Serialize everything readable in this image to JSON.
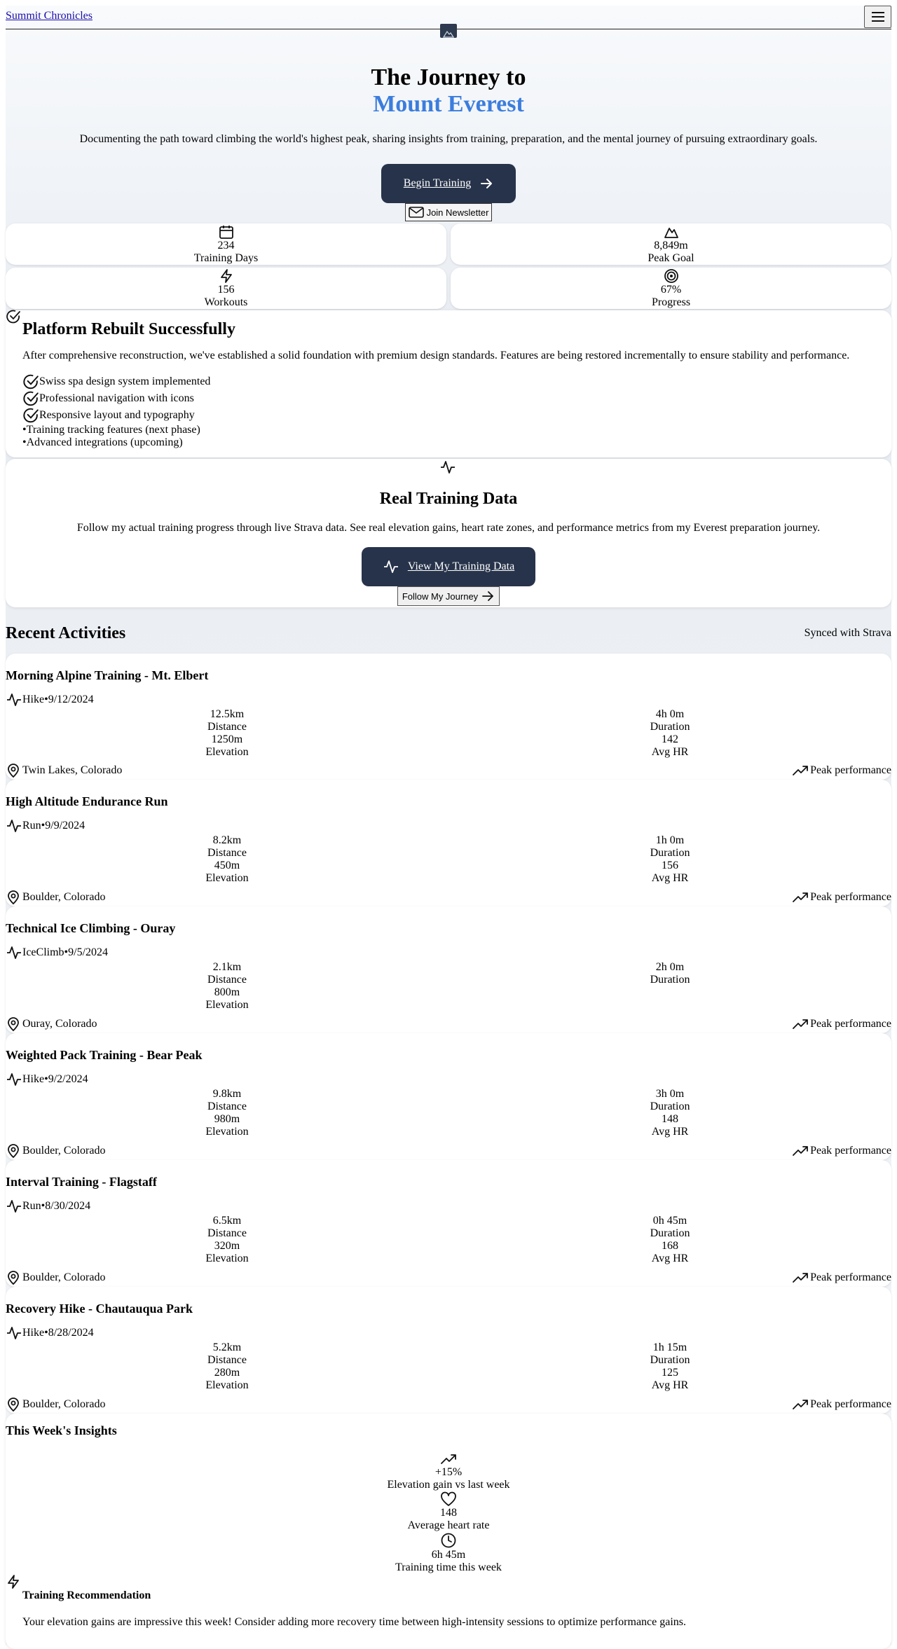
{
  "header": {
    "brand": "Summit Chronicles",
    "menu_icon": "menu-icon"
  },
  "hero": {
    "title_line1": "The Journey to",
    "title_line2": "Mount Everest",
    "subtitle": "Documenting the path toward climbing the world's highest peak, sharing insights from training, preparation, and the mental journey of pursuing extraordinary goals.",
    "cta_label": "Begin Training",
    "newsletter_label": "Join Newsletter"
  },
  "stats": [
    {
      "icon": "calendar-icon",
      "value": "234",
      "label": "Training Days"
    },
    {
      "icon": "mountain-icon",
      "value": "8,849m",
      "label": "Peak Goal"
    },
    {
      "icon": "zap-icon",
      "value": "156",
      "label": "Workouts"
    },
    {
      "icon": "target-icon",
      "value": "67%",
      "label": "Progress"
    }
  ],
  "rebuilt": {
    "title": "Platform Rebuilt Successfully",
    "description": "After comprehensive reconstruction, we've established a solid foundation with premium design standards. Features are being restored incrementally to ensure stability and performance.",
    "done": [
      "Swiss spa design system implemented",
      "Professional navigation with icons",
      "Responsive layout and typography"
    ],
    "upcoming": [
      "Training tracking features (next phase)",
      "Advanced integrations (upcoming)"
    ]
  },
  "strava": {
    "title": "Real Training Data",
    "description": "Follow my actual training progress through live Strava data. See real elevation gains, heart rate zones, and performance metrics from my Everest preparation journey.",
    "cta_label": "View My Training Data",
    "follow_label": "Follow My Journey"
  },
  "recent": {
    "title": "Recent Activities",
    "synced": "Synced with Strava",
    "labels": {
      "distance": "Distance",
      "duration": "Duration",
      "elevation": "Elevation",
      "hr": "Avg HR",
      "performance": "Peak performance"
    },
    "activities": [
      {
        "title": "Morning Alpine Training - Mt. Elbert",
        "type": "Hike",
        "date": "9/12/2024",
        "distance": "12.5km",
        "duration": "4h 0m",
        "elevation": "1250m",
        "hr": "142",
        "location": "Twin Lakes, Colorado"
      },
      {
        "title": "High Altitude Endurance Run",
        "type": "Run",
        "date": "9/9/2024",
        "distance": "8.2km",
        "duration": "1h 0m",
        "elevation": "450m",
        "hr": "156",
        "location": "Boulder, Colorado"
      },
      {
        "title": "Technical Ice Climbing - Ouray",
        "type": "IceClimb",
        "date": "9/5/2024",
        "distance": "2.1km",
        "duration": "2h 0m",
        "elevation": "800m",
        "hr": null,
        "location": "Ouray, Colorado"
      },
      {
        "title": "Weighted Pack Training - Bear Peak",
        "type": "Hike",
        "date": "9/2/2024",
        "distance": "9.8km",
        "duration": "3h 0m",
        "elevation": "980m",
        "hr": "148",
        "location": "Boulder, Colorado"
      },
      {
        "title": "Interval Training - Flagstaff",
        "type": "Run",
        "date": "8/30/2024",
        "distance": "6.5km",
        "duration": "0h 45m",
        "elevation": "320m",
        "hr": "168",
        "location": "Boulder, Colorado"
      },
      {
        "title": "Recovery Hike - Chautauqua Park",
        "type": "Hike",
        "date": "8/28/2024",
        "distance": "5.2km",
        "duration": "1h 15m",
        "elevation": "280m",
        "hr": "125",
        "location": "Boulder, Colorado"
      }
    ]
  },
  "insights": {
    "title": "This Week's Insights",
    "items": [
      {
        "icon": "trending-up-icon",
        "value": "+15%",
        "label": "Elevation gain vs last week"
      },
      {
        "icon": "heart-icon",
        "value": "148",
        "label": "Average heart rate"
      },
      {
        "icon": "clock-icon",
        "value": "6h 45m",
        "label": "Training time this week"
      }
    ],
    "recommendation_title": "Training Recommendation",
    "recommendation_text": "Your elevation gains are impressive this week! Consider adding more recovery time between high-intensity sessions to optimize performance gains."
  },
  "colors": {
    "accent": "#3b7ddd",
    "button_dark": "#27334a"
  }
}
